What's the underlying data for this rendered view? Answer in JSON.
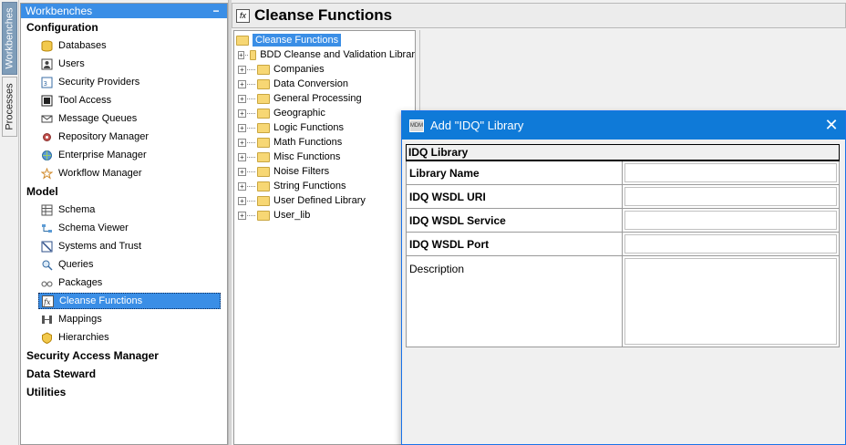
{
  "side_tabs": [
    "Workbenches",
    "Processes"
  ],
  "navigator": {
    "header": "Workbenches",
    "collapse_symbol": "−",
    "groups": [
      {
        "title": "Configuration",
        "items": [
          {
            "label": "Databases",
            "icon": "database-icon"
          },
          {
            "label": "Users",
            "icon": "users-icon"
          },
          {
            "label": "Security Providers",
            "icon": "security-providers-icon"
          },
          {
            "label": "Tool Access",
            "icon": "tool-access-icon"
          },
          {
            "label": "Message Queues",
            "icon": "message-queues-icon"
          },
          {
            "label": "Repository Manager",
            "icon": "repository-manager-icon"
          },
          {
            "label": "Enterprise Manager",
            "icon": "enterprise-manager-icon"
          },
          {
            "label": "Workflow Manager",
            "icon": "workflow-manager-icon"
          }
        ]
      },
      {
        "title": "Model",
        "items": [
          {
            "label": "Schema",
            "icon": "schema-icon"
          },
          {
            "label": "Schema Viewer",
            "icon": "schema-viewer-icon"
          },
          {
            "label": "Systems and Trust",
            "icon": "systems-trust-icon"
          },
          {
            "label": "Queries",
            "icon": "queries-icon"
          },
          {
            "label": "Packages",
            "icon": "packages-icon"
          },
          {
            "label": "Cleanse Functions",
            "icon": "cleanse-functions-icon",
            "selected": true
          },
          {
            "label": "Mappings",
            "icon": "mappings-icon"
          },
          {
            "label": "Hierarchies",
            "icon": "hierarchies-icon"
          }
        ]
      }
    ],
    "other_groups": [
      "Security Access Manager",
      "Data Steward",
      "Utilities"
    ]
  },
  "main": {
    "title": "Cleanse Functions",
    "title_icon": "fx",
    "tree": {
      "root": "Cleanse Functions",
      "nodes": [
        "BDD Cleanse and Validation Librar",
        "Companies",
        "Data Conversion",
        "General Processing",
        "Geographic",
        "Logic Functions",
        "Math Functions",
        "Misc Functions",
        "Noise Filters",
        "String Functions",
        "User Defined Library",
        "User_lib"
      ]
    }
  },
  "dialog": {
    "title": "Add \"IDQ\" Library",
    "app_icon_text": "MDM",
    "close_symbol": "✕",
    "section": "IDQ Library",
    "fields": {
      "library_name": {
        "label": "Library Name",
        "value": ""
      },
      "wsdl_uri": {
        "label": "IDQ WSDL URI",
        "value": ""
      },
      "wsdl_service": {
        "label": "IDQ WSDL Service",
        "value": ""
      },
      "wsdl_port": {
        "label": "IDQ WSDL Port",
        "value": ""
      },
      "description": {
        "label": "Description",
        "value": ""
      }
    }
  },
  "colors": {
    "accent": "#3a8ee6",
    "dialog_title": "#0f7ad8",
    "folder": "#f7d774"
  }
}
